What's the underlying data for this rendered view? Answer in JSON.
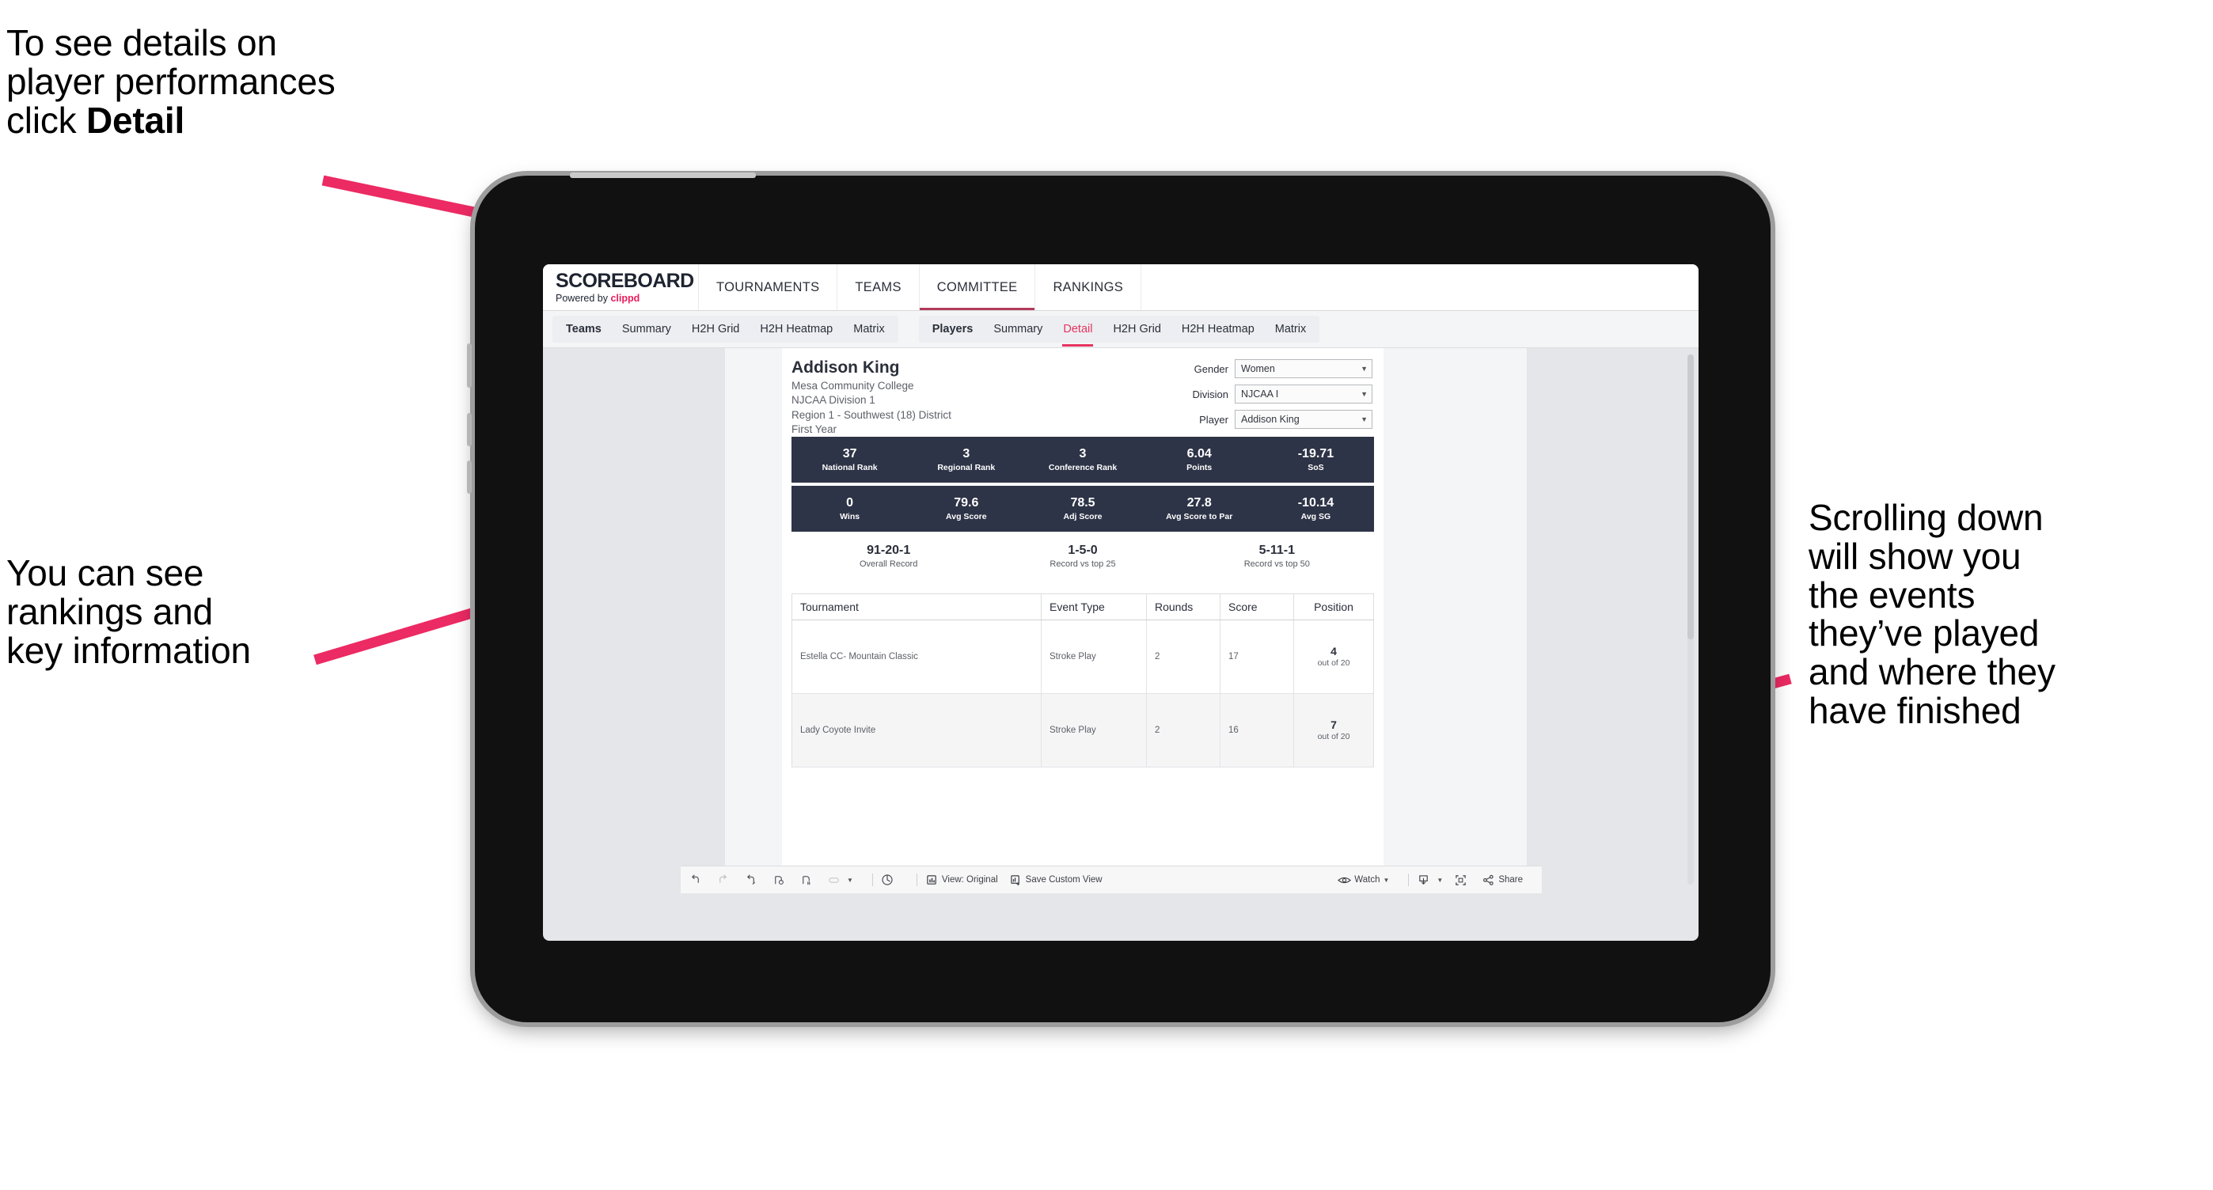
{
  "annotations": {
    "top_left": "To see details on\nplayer performances\nclick ",
    "top_left_bold": "Detail",
    "mid_left": "You can see\nrankings and\nkey information",
    "right": "Scrolling down\nwill show you\nthe events\nthey’ve played\nand where they\nhave finished",
    "arrow_color": "#ec2a63"
  },
  "app": {
    "brand": {
      "title": "SCOREBOARD",
      "powered_prefix": "Powered by ",
      "powered_brand": "clippd"
    },
    "topnav": [
      {
        "label": "TOURNAMENTS",
        "active": false
      },
      {
        "label": "TEAMS",
        "active": false
      },
      {
        "label": "COMMITTEE",
        "active": true
      },
      {
        "label": "RANKINGS",
        "active": false
      }
    ],
    "subnav": {
      "teams_group": [
        {
          "label": "Teams",
          "active": false,
          "is_group_label": true
        },
        {
          "label": "Summary",
          "active": false
        },
        {
          "label": "H2H Grid",
          "active": false
        },
        {
          "label": "H2H Heatmap",
          "active": false
        },
        {
          "label": "Matrix",
          "active": false
        }
      ],
      "players_group": [
        {
          "label": "Players",
          "active": false,
          "is_group_label": true
        },
        {
          "label": "Summary",
          "active": false
        },
        {
          "label": "Detail",
          "active": true
        },
        {
          "label": "H2H Grid",
          "active": false
        },
        {
          "label": "H2H Heatmap",
          "active": false
        },
        {
          "label": "Matrix",
          "active": false
        }
      ]
    },
    "player": {
      "name": "Addison King",
      "school": "Mesa Community College",
      "division": "NJCAA Division 1",
      "region": "Region 1 - Southwest (18) District",
      "year": "First Year"
    },
    "filters": [
      {
        "label": "Gender",
        "value": "Women"
      },
      {
        "label": "Division",
        "value": "NJCAA I"
      },
      {
        "label": "Player",
        "value": "Addison King"
      }
    ],
    "stat_bar_1": [
      {
        "value": "37",
        "label": "National Rank"
      },
      {
        "value": "3",
        "label": "Regional Rank"
      },
      {
        "value": "3",
        "label": "Conference Rank"
      },
      {
        "value": "6.04",
        "label": "Points"
      },
      {
        "value": "-19.71",
        "label": "SoS"
      }
    ],
    "stat_bar_2": [
      {
        "value": "0",
        "label": "Wins"
      },
      {
        "value": "79.6",
        "label": "Avg Score"
      },
      {
        "value": "78.5",
        "label": "Adj Score"
      },
      {
        "value": "27.8",
        "label": "Avg Score to Par"
      },
      {
        "value": "-10.14",
        "label": "Avg SG"
      }
    ],
    "records": [
      {
        "value": "91-20-1",
        "label": "Overall Record"
      },
      {
        "value": "1-5-0",
        "label": "Record vs top 25"
      },
      {
        "value": "5-11-1",
        "label": "Record vs top 50"
      }
    ],
    "table": {
      "headers": [
        "Tournament",
        "Event Type",
        "Rounds",
        "Score",
        "Position"
      ],
      "rows": [
        {
          "tournament": "Estella CC- Mountain Classic",
          "event_type": "Stroke Play",
          "rounds": "2",
          "score": "17",
          "position": "4",
          "position_sub": "out of 20"
        },
        {
          "tournament": "Lady Coyote Invite",
          "event_type": "Stroke Play",
          "rounds": "2",
          "score": "16",
          "position": "7",
          "position_sub": "out of 20"
        }
      ]
    },
    "toolbar": {
      "view_label": "View: Original",
      "save_label": "Save Custom View",
      "watch_label": "Watch",
      "share_label": "Share"
    },
    "colors": {
      "navy": "#2e3447",
      "accent_pink": "#e5335f",
      "brand_pink": "#ec1c5c"
    }
  }
}
